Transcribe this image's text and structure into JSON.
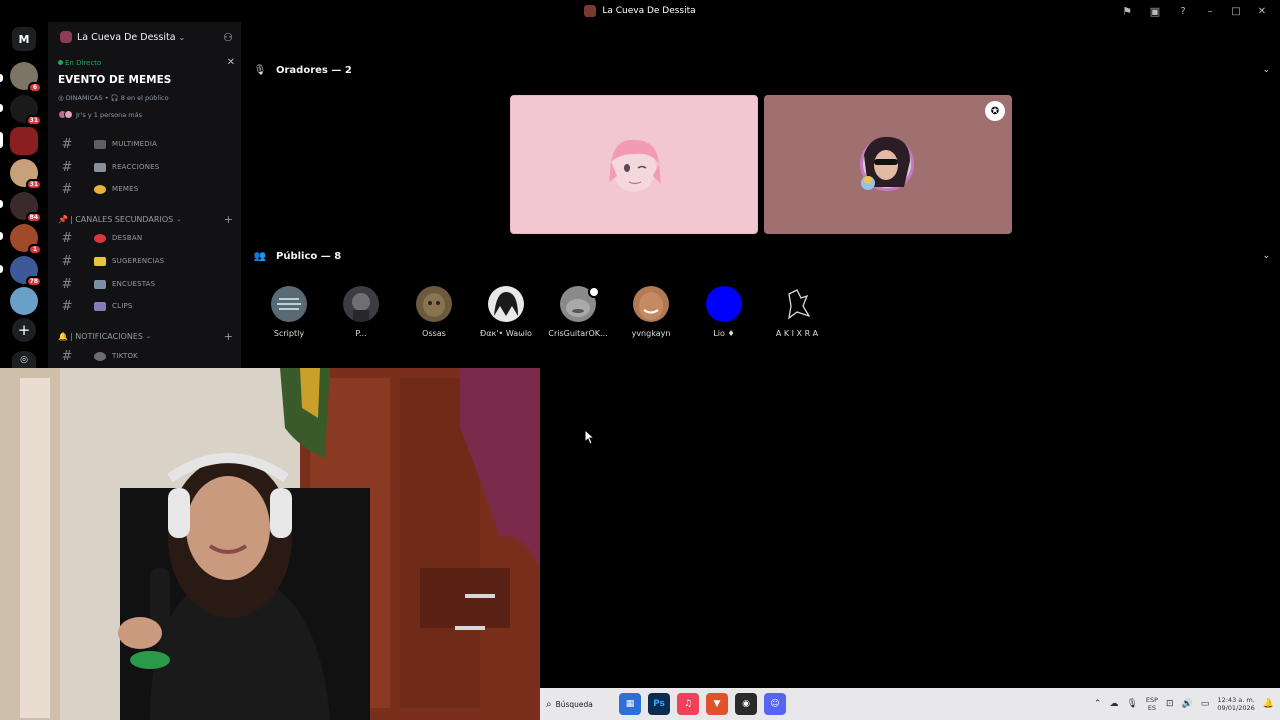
{
  "window": {
    "title": "La Cueva De Dessita"
  },
  "rail": {
    "home_label": "M",
    "badges": [
      "6",
      "31",
      "31",
      "84",
      "1",
      "78"
    ]
  },
  "sidebar": {
    "server_name": "La Cueva De Dessita",
    "event": {
      "live_label": "En Directo",
      "title": "EVENTO DE MEMES",
      "stage_channel": "DINAMICAS",
      "audience_text": "8 en el público",
      "speakers_text": "Jr's y 1 persona más"
    },
    "channels_top": [
      {
        "name": "MULTIMEDIA"
      },
      {
        "name": "REACCIONES"
      },
      {
        "name": "MEMES"
      }
    ],
    "category_secondary": "| CANALES SECUNDARIOS",
    "channels_secondary": [
      {
        "name": "DESBAN"
      },
      {
        "name": "SUGERENCIAS"
      },
      {
        "name": "ENCUESTAS"
      },
      {
        "name": "CLIPS"
      }
    ],
    "category_notifications": "| NOTIFICACIONES",
    "channels_notifications": [
      {
        "name": "TIKTOK"
      }
    ]
  },
  "stage": {
    "speakers_label": "Oradores — 2",
    "audience_label": "Público — 8",
    "audience": [
      {
        "name": "Scriptly",
        "color": "#5a6a74"
      },
      {
        "name": "P...",
        "color": "#3b3d42"
      },
      {
        "name": "Ossas",
        "color": "#6b5a3e"
      },
      {
        "name": "Đαк'• Waωlo",
        "color": "#2b2b2b"
      },
      {
        "name": "CrisGuitarOK...",
        "color": "#8a8a8a"
      },
      {
        "name": "yvngkayn",
        "color": "#b07a55"
      },
      {
        "name": "Lio ♦",
        "color": "#0000ff"
      },
      {
        "name": "A K I X R A",
        "color": "#1a1a1a"
      }
    ]
  },
  "taskbar": {
    "search_label": "Búsqueda",
    "apps": [
      {
        "label": "▦",
        "color": "#2d6fd6"
      },
      {
        "label": "Ps",
        "color": "#0b2b4f"
      },
      {
        "label": "♫",
        "color": "#f0405a"
      },
      {
        "label": "▼",
        "color": "#e0522c"
      },
      {
        "label": "◉",
        "color": "#2b2b2b"
      },
      {
        "label": "☺",
        "color": "#5865f2"
      }
    ],
    "lang_line1": "ESP",
    "lang_line2": "ES",
    "time": "12:43 a. m.",
    "date": "09/01/2026"
  }
}
